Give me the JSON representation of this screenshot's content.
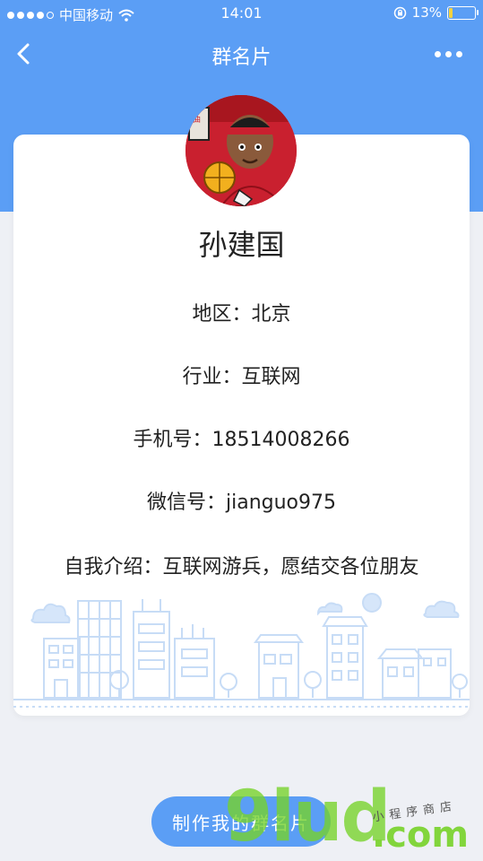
{
  "status_bar": {
    "carrier": "中国移动",
    "time": "14:01",
    "battery": "13%",
    "battery_level": 0.13
  },
  "nav": {
    "title": "群名片"
  },
  "profile": {
    "name": "孙建国",
    "region": "地区：北京",
    "industry": "行业：互联网",
    "phone": "手机号：18514008266",
    "wechat": "微信号：jianguo975",
    "intro": "自我介绍：互联网游兵，愿结交各位朋友"
  },
  "action": {
    "make_card_label": "制作我的群名片"
  },
  "watermark": {
    "big": "9lud",
    "suffix": ".com",
    "cn": "小程序商店"
  },
  "colors": {
    "brand": "#5b9ef5",
    "background": "#eef0f5",
    "illustration": "#c7dcf6"
  }
}
